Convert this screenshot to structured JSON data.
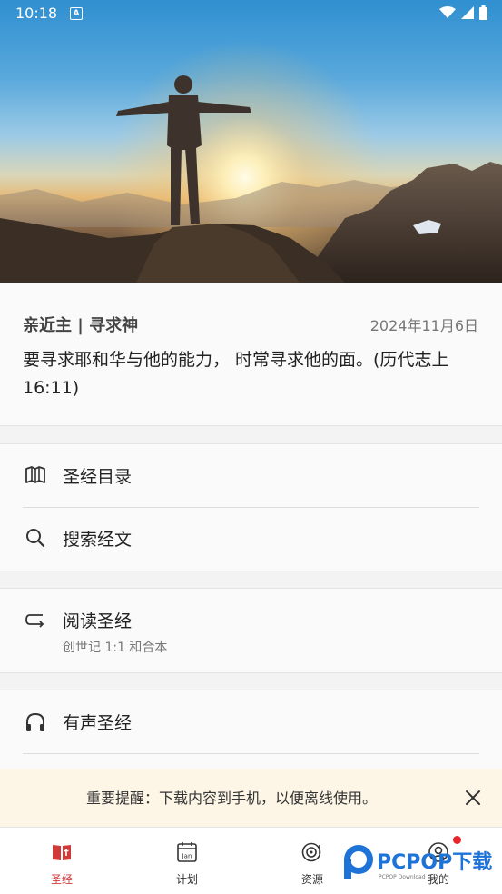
{
  "status_bar": {
    "time": "10:18",
    "notification_icon": "a-letter-icon"
  },
  "verse": {
    "title": "亲近主 | 寻求神",
    "date": "2024年11月6日",
    "text": "要寻求耶和华与他的能力， 时常寻求他的面。(历代志上 16:11)"
  },
  "menu": {
    "catalog_label": "圣经目录",
    "search_label": "搜索经文",
    "read_label": "阅读圣经",
    "read_sub": "创世记 1:1 和合本",
    "audio_label": "有声圣经"
  },
  "notice": {
    "text": "重要提醒：下载内容到手机，以便离线使用。"
  },
  "nav": {
    "bible": "圣经",
    "plan": "计划",
    "plan_icon_text": "Jan",
    "resources": "资源",
    "mine": "我的"
  },
  "watermark": {
    "brand": "PCPOP下载",
    "sub": "PCPOP Download"
  },
  "colors": {
    "accent": "#d23a3a",
    "notice_bg": "#fdf6e7",
    "badge": "#e8252a"
  }
}
